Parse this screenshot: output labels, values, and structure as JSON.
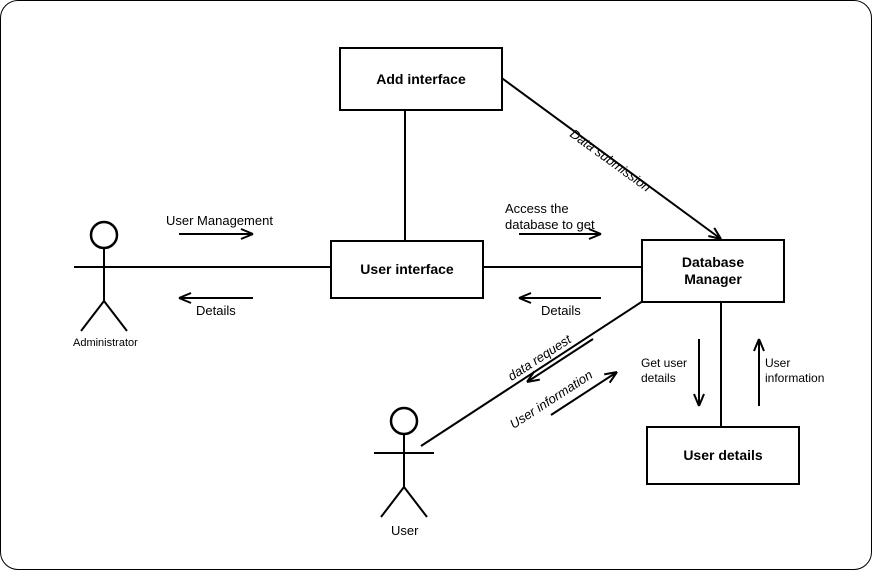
{
  "boxes": {
    "add_interface": "Add interface",
    "user_interface": "User interface",
    "database_manager": "Database\nManager",
    "user_details": "User details"
  },
  "actors": {
    "administrator": "Administrator",
    "user": "User"
  },
  "labels": {
    "user_management": "User Management",
    "details_left": "Details",
    "access_db": "Access the\ndatabase to get",
    "details_mid": "Details",
    "data_submission": "Data submission",
    "data_request": "data request",
    "user_information_diag": "User  information",
    "get_user_details": "Get user\ndetails",
    "user_information_right": "User\ninformation"
  }
}
